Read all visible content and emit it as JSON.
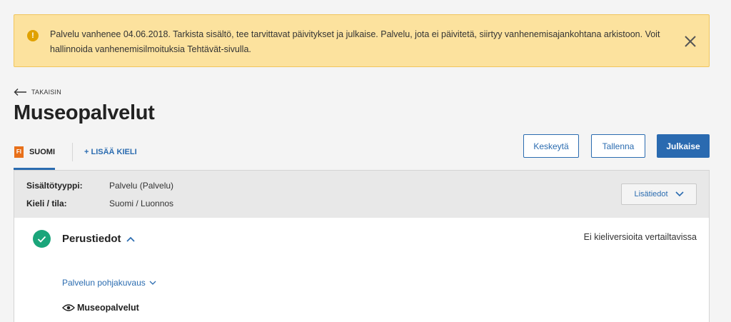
{
  "alert": {
    "text": "Palvelu vanhenee 04.06.2018. Tarkista sisältö, tee tarvittavat päivitykset ja julkaise. Palvelu, jota ei päivitetä, siirtyy vanhenemisajankohtana arkistoon. Voit hallinnoida vanhenemisilmoituksia Tehtävät-sivulla.",
    "icon_symbol": "!",
    "icon_color": "#e0a100",
    "background": "#fce29e"
  },
  "nav": {
    "back_label": "TAKAISIN"
  },
  "page": {
    "title": "Museopalvelut"
  },
  "tabs": {
    "language_code": "FI",
    "language_label": "SUOMI",
    "add_language_label": "+ LISÄÄ KIELI"
  },
  "actions": {
    "cancel_label": "Keskeytä",
    "save_label": "Tallenna",
    "publish_label": "Julkaise"
  },
  "info": {
    "content_type_label": "Sisältötyyppi:",
    "content_type_value": "Palvelu (Palvelu)",
    "language_state_label": "Kieli / tila:",
    "language_state_value": "Suomi / Luonnos",
    "more_info_label": "Lisätiedot"
  },
  "section": {
    "title": "Perustiedot",
    "compare_note": "Ei kieliversioita vertailtavissa",
    "sub_link_label": "Palvelun pohjakuvaus",
    "preview_text": "Museopalvelut",
    "status_color": "#1aa57a"
  },
  "theme": {
    "accent": "#2b6cb0",
    "primary_button": "#2a6ab0"
  }
}
